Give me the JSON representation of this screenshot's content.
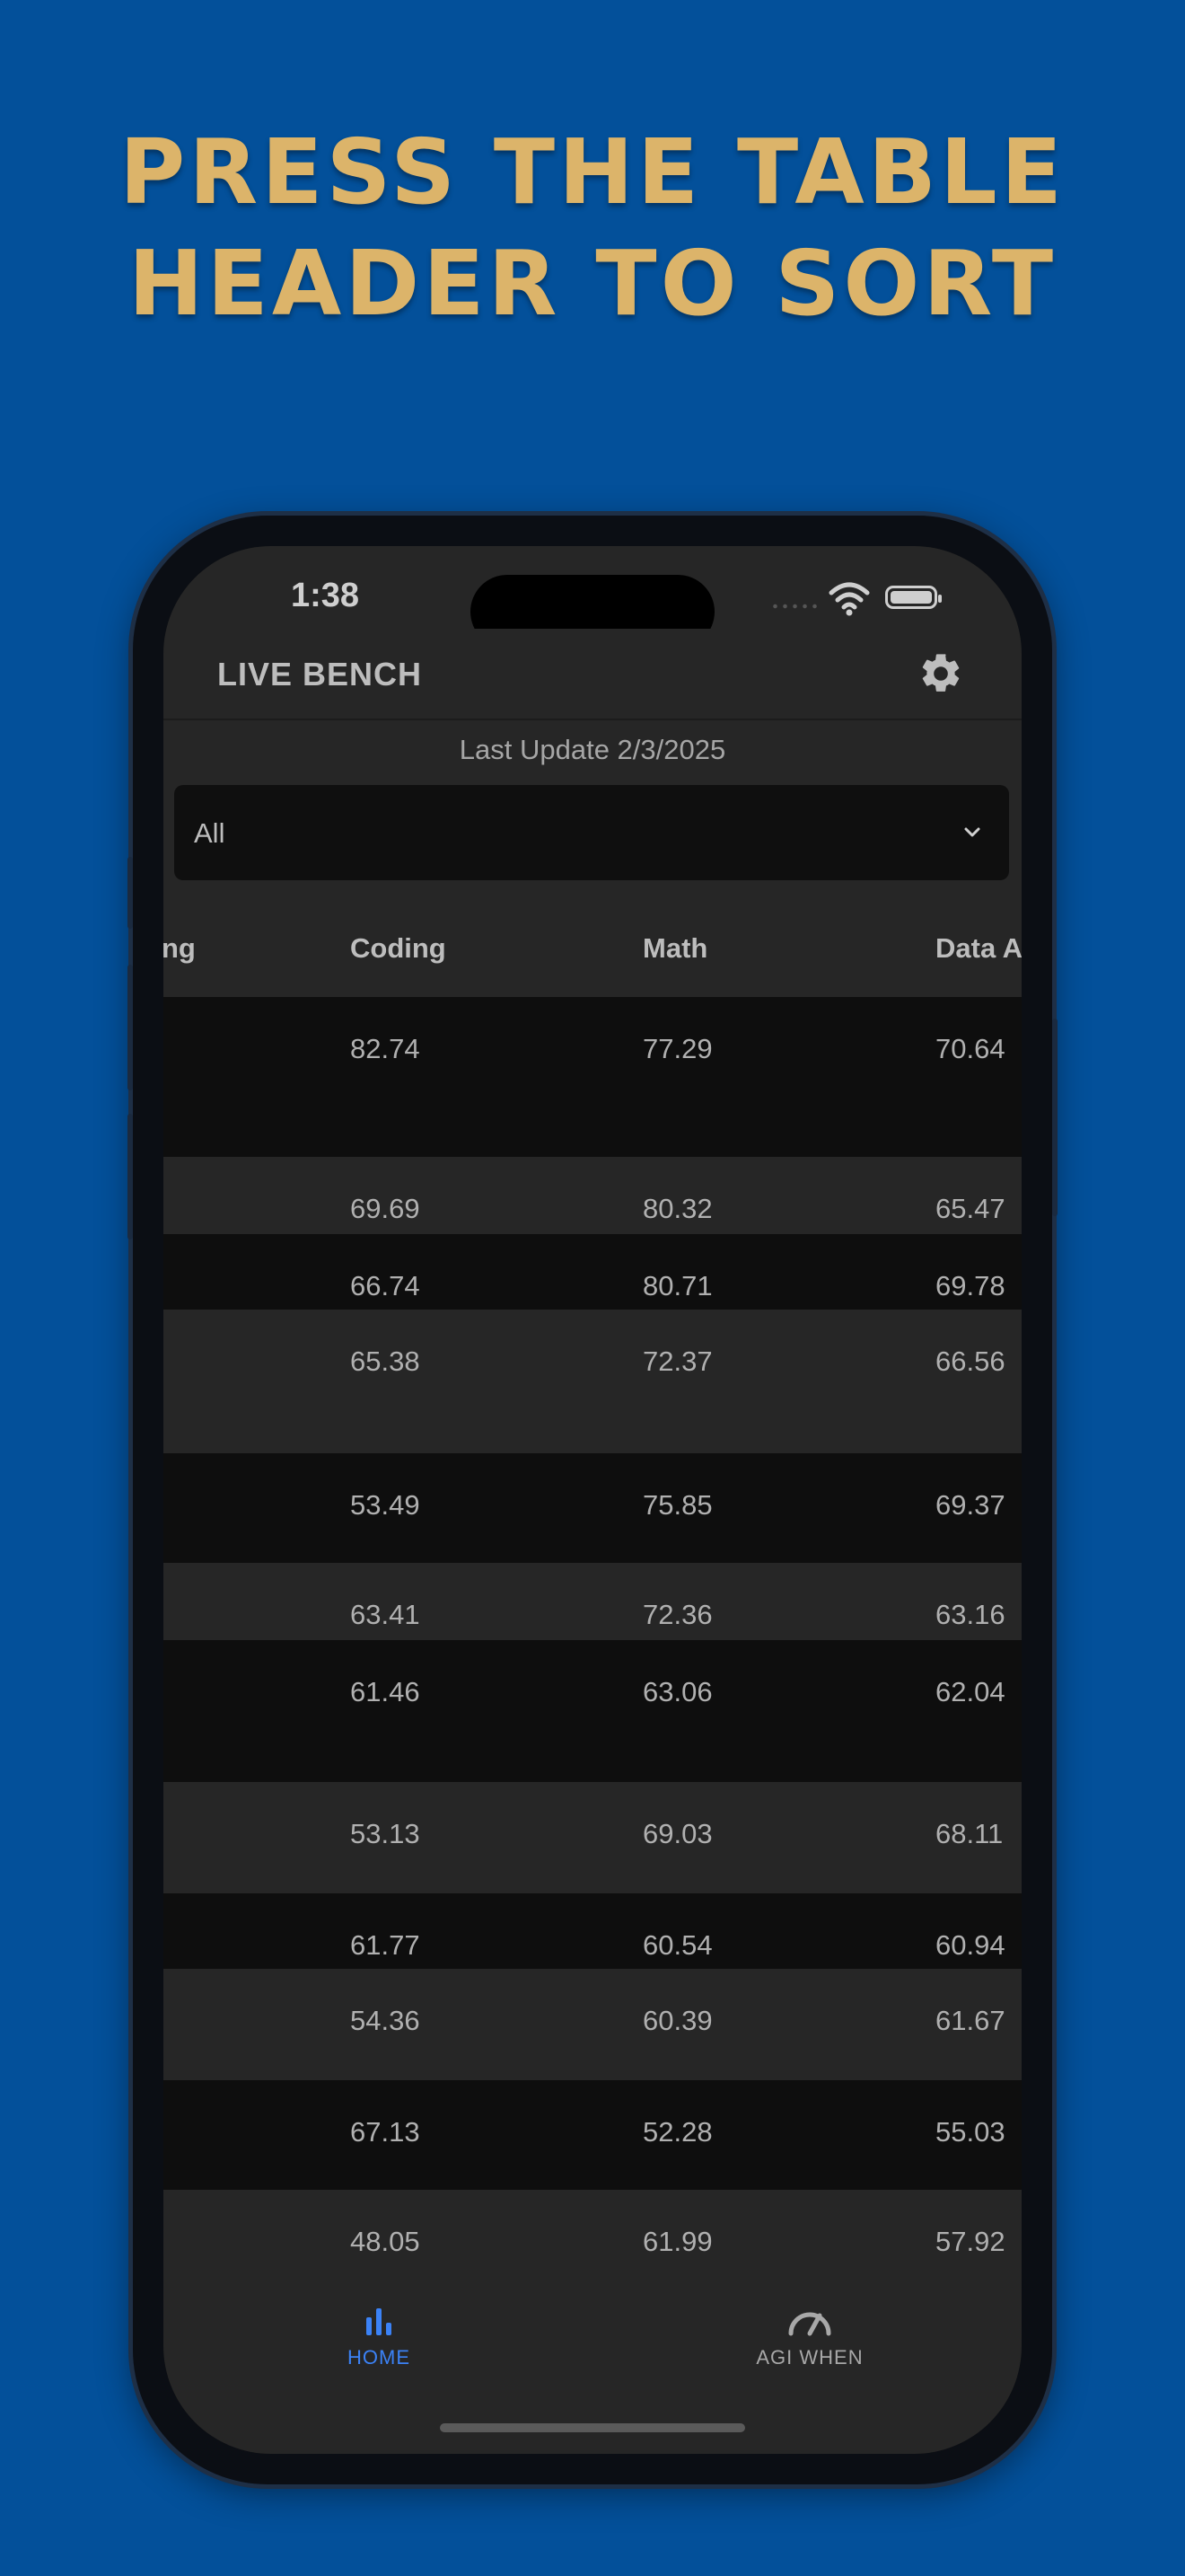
{
  "headline": {
    "line1": "PRESS THE TABLE",
    "line2": "HEADER TO SORT"
  },
  "status_bar": {
    "time": "1:38"
  },
  "app": {
    "title": "LIVE BENCH",
    "settings_icon": "gear-icon"
  },
  "last_update": "Last Update 2/3/2025",
  "filter": {
    "selected": "All"
  },
  "table": {
    "columns": [
      "ng",
      "Coding",
      "Math",
      "Data A"
    ],
    "rows": [
      {
        "coding": "82.74",
        "math": "77.29",
        "data": "70.64"
      },
      {
        "coding": "69.69",
        "math": "80.32",
        "data": "65.47"
      },
      {
        "coding": "66.74",
        "math": "80.71",
        "data": "69.78"
      },
      {
        "coding": "65.38",
        "math": "72.37",
        "data": "66.56"
      },
      {
        "coding": "53.49",
        "math": "75.85",
        "data": "69.37"
      },
      {
        "coding": "63.41",
        "math": "72.36",
        "data": "63.16"
      },
      {
        "coding": "61.46",
        "math": "63.06",
        "data": "62.04"
      },
      {
        "coding": "53.13",
        "math": "69.03",
        "data": "68.11"
      },
      {
        "coding": "61.77",
        "math": "60.54",
        "data": "60.94"
      },
      {
        "coding": "54.36",
        "math": "60.39",
        "data": "61.67"
      },
      {
        "coding": "67.13",
        "math": "52.28",
        "data": "55.03"
      },
      {
        "coding": "48.05",
        "math": "61.99",
        "data": "57.92"
      }
    ]
  },
  "tabs": [
    {
      "label": "HOME",
      "icon": "bar-chart-icon",
      "active": true
    },
    {
      "label": "AGI WHEN",
      "icon": "speedometer-icon",
      "active": false
    }
  ],
  "colors": {
    "background": "#03509a",
    "headline": "#dcb46a",
    "active_tab": "#3b82f6",
    "inactive_tab": "#a8a8a8"
  }
}
